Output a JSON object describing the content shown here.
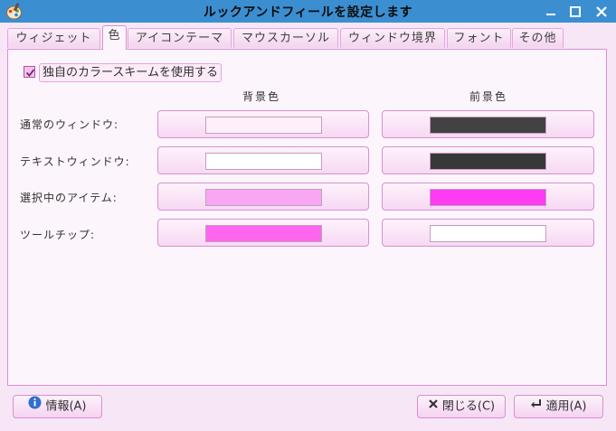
{
  "window": {
    "title": "ルックアンドフィールを設定します",
    "app_icon": "paint-palette-icon",
    "controls": [
      "minimize-icon",
      "maximize-icon",
      "close-icon"
    ],
    "titlebar_color": "#3b8fd1"
  },
  "tabs": [
    {
      "label": "ウィジェット",
      "active": false
    },
    {
      "label": "色",
      "active": true
    },
    {
      "label": "アイコンテーマ",
      "active": false
    },
    {
      "label": "マウスカーソル",
      "active": false
    },
    {
      "label": "ウィンドウ境界",
      "active": false
    },
    {
      "label": "フォント",
      "active": false
    },
    {
      "label": "その他",
      "active": false
    }
  ],
  "custom_scheme": {
    "label": "独自のカラースキームを使用する",
    "checked": true
  },
  "columns": {
    "background": "背景色",
    "foreground": "前景色"
  },
  "rows": [
    {
      "label": "通常のウィンドウ:",
      "bg": "#fdf0fb",
      "fg": "#424242"
    },
    {
      "label": "テキストウィンドウ:",
      "bg": "#ffffff",
      "fg": "#383838"
    },
    {
      "label": "選択中のアイテム:",
      "bg": "#f8a8f2",
      "fg": "#ff3cf2"
    },
    {
      "label": "ツールチップ:",
      "bg": "#ff66f0",
      "fg": "#ffffff"
    }
  ],
  "buttons": {
    "about": {
      "label": "情報(A)",
      "icon": "info-icon"
    },
    "close": {
      "label": "閉じる(C)",
      "icon": "close-x-icon"
    },
    "apply": {
      "label": "適用(A)",
      "icon": "enter-arrow-icon"
    }
  },
  "colors": {
    "accent_border": "#d98fd2",
    "background": "#f7e6f5",
    "panel": "#fdf5fc"
  }
}
